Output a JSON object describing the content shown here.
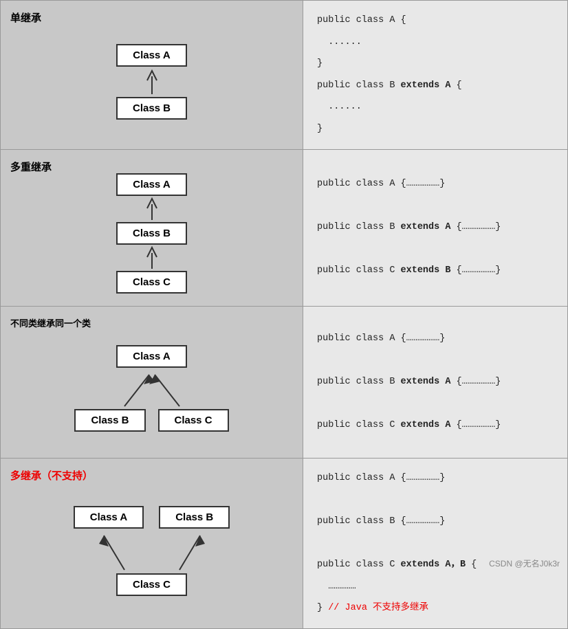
{
  "rows": [
    {
      "label": "单继承",
      "label_color": "black",
      "type": "single",
      "diagram": {
        "top": "Class A",
        "bottom": "Class B"
      },
      "code_lines": [
        {
          "text": "public class A {",
          "parts": [
            {
              "t": "public class A {",
              "b": false,
              "r": false
            }
          ]
        },
        {
          "text": "  ......",
          "parts": [
            {
              "t": "  ......",
              "b": false,
              "r": false
            }
          ]
        },
        {
          "text": "}",
          "parts": [
            {
              "t": "}",
              "b": false,
              "r": false
            }
          ]
        },
        {
          "text": "public class B extends A {",
          "parts": [
            {
              "t": "public class B ",
              "b": false,
              "r": false
            },
            {
              "t": "extends A",
              "b": true,
              "r": false
            },
            {
              "t": " {",
              "b": false,
              "r": false
            }
          ]
        },
        {
          "text": "  ......",
          "parts": [
            {
              "t": "  ......",
              "b": false,
              "r": false
            }
          ]
        },
        {
          "text": "}",
          "parts": [
            {
              "t": "}",
              "b": false,
              "r": false
            }
          ]
        }
      ]
    },
    {
      "label": "多重继承",
      "label_color": "black",
      "type": "chain",
      "diagram": {
        "classes": [
          "Class A",
          "Class B",
          "Class C"
        ]
      },
      "code_lines": [
        {
          "parts": [
            {
              "t": "public class A {………………}",
              "b": false,
              "r": false
            }
          ]
        },
        {
          "parts": []
        },
        {
          "parts": [
            {
              "t": "public class B ",
              "b": false,
              "r": false
            },
            {
              "t": "extends A",
              "b": true,
              "r": false
            },
            {
              "t": " {………………}",
              "b": false,
              "r": false
            }
          ]
        },
        {
          "parts": []
        },
        {
          "parts": [
            {
              "t": "public class C ",
              "b": false,
              "r": false
            },
            {
              "t": "extends B",
              "b": true,
              "r": false
            },
            {
              "t": " {………………}",
              "b": false,
              "r": false
            }
          ]
        }
      ]
    },
    {
      "label": "不同类继承同一个类",
      "label_color": "black",
      "type": "fan-in",
      "diagram": {
        "top": "Class A",
        "bottom_left": "Class B",
        "bottom_right": "Class C"
      },
      "code_lines": [
        {
          "parts": [
            {
              "t": "public class A {………………}",
              "b": false,
              "r": false
            }
          ]
        },
        {
          "parts": []
        },
        {
          "parts": [
            {
              "t": "public class B ",
              "b": false,
              "r": false
            },
            {
              "t": "extends A",
              "b": true,
              "r": false
            },
            {
              "t": " {………………}",
              "b": false,
              "r": false
            }
          ]
        },
        {
          "parts": []
        },
        {
          "parts": [
            {
              "t": "public class C ",
              "b": false,
              "r": false
            },
            {
              "t": "extends A",
              "b": true,
              "r": false
            },
            {
              "t": " {………………}",
              "b": false,
              "r": false
            }
          ]
        }
      ]
    },
    {
      "label": "多继承（不支持）",
      "label_color": "red",
      "type": "fan-out",
      "diagram": {
        "top_left": "Class A",
        "top_right": "Class B",
        "bottom": "Class C"
      },
      "code_lines": [
        {
          "parts": [
            {
              "t": "public class A {………………}",
              "b": false,
              "r": false
            }
          ]
        },
        {
          "parts": []
        },
        {
          "parts": [
            {
              "t": "public class B {………………}",
              "b": false,
              "r": false
            }
          ]
        },
        {
          "parts": []
        },
        {
          "parts": [
            {
              "t": "public class C ",
              "b": false,
              "r": false
            },
            {
              "t": "extends A，B",
              "b": true,
              "r": false
            },
            {
              "t": " {",
              "b": false,
              "r": false
            }
          ]
        },
        {
          "parts": [
            {
              "t": "  ……………",
              "b": false,
              "r": false
            }
          ]
        },
        {
          "parts": [
            {
              "t": "}",
              "b": false,
              "r": false
            },
            {
              "t": "// Java 不支持多继承",
              "b": false,
              "r": true
            }
          ]
        }
      ]
    }
  ]
}
